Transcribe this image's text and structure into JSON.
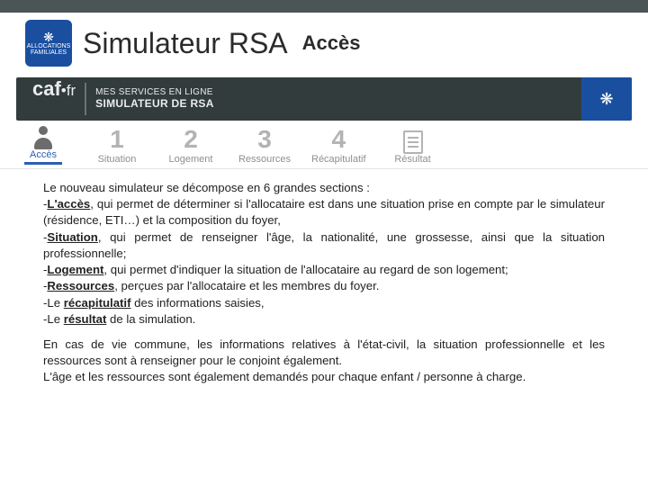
{
  "header": {
    "logo_line1": "ALLOCATIONS",
    "logo_line2": "FAMILIALES",
    "title": "Simulateur RSA",
    "subtitle": "Accès"
  },
  "cafbar": {
    "brand": "caf",
    "brand_suffix": "•fr",
    "line1": "MES SERVICES EN LIGNE",
    "line2": "SIMULATEUR DE RSA"
  },
  "steps": [
    {
      "num": "",
      "label": "Accès",
      "icon": "person",
      "active": true
    },
    {
      "num": "1",
      "label": "Situation",
      "icon": "num"
    },
    {
      "num": "2",
      "label": "Logement",
      "icon": "num"
    },
    {
      "num": "3",
      "label": "Ressources",
      "icon": "num"
    },
    {
      "num": "4",
      "label": "Récapitulatif",
      "icon": "num"
    },
    {
      "num": "",
      "label": "Résultat",
      "icon": "doc"
    }
  ],
  "body": {
    "intro": "Le nouveau simulateur se décompose en 6 grandes sections :",
    "items": [
      {
        "pre": "-",
        "term": "L'accès",
        "rest": ", qui permet de déterminer si l'allocataire est dans une situation prise en compte par le simulateur (résidence, ETI…) et la composition du foyer,"
      },
      {
        "pre": "-",
        "term": "Situation",
        "rest": ", qui permet de renseigner l'âge, la nationalité, une grossesse, ainsi que la situation professionnelle;"
      },
      {
        "pre": "-",
        "term": "Logement",
        "rest": ", qui permet d'indiquer la situation de l'allocataire au regard de son logement;"
      },
      {
        "pre": "-",
        "term": "Ressources",
        "rest": ", perçues par l'allocataire et les membres du foyer."
      },
      {
        "pre": "-Le ",
        "term": "récapitulatif",
        "rest": " des informations saisies,"
      },
      {
        "pre": "-Le ",
        "term": "résultat",
        "rest": " de la simulation."
      }
    ],
    "para2a": "En cas de vie commune, les informations relatives à l'état-civil, la situation professionnelle et les ressources sont à renseigner pour le conjoint également.",
    "para2b": "L'âge et les ressources sont également demandés pour chaque enfant / personne à charge."
  }
}
